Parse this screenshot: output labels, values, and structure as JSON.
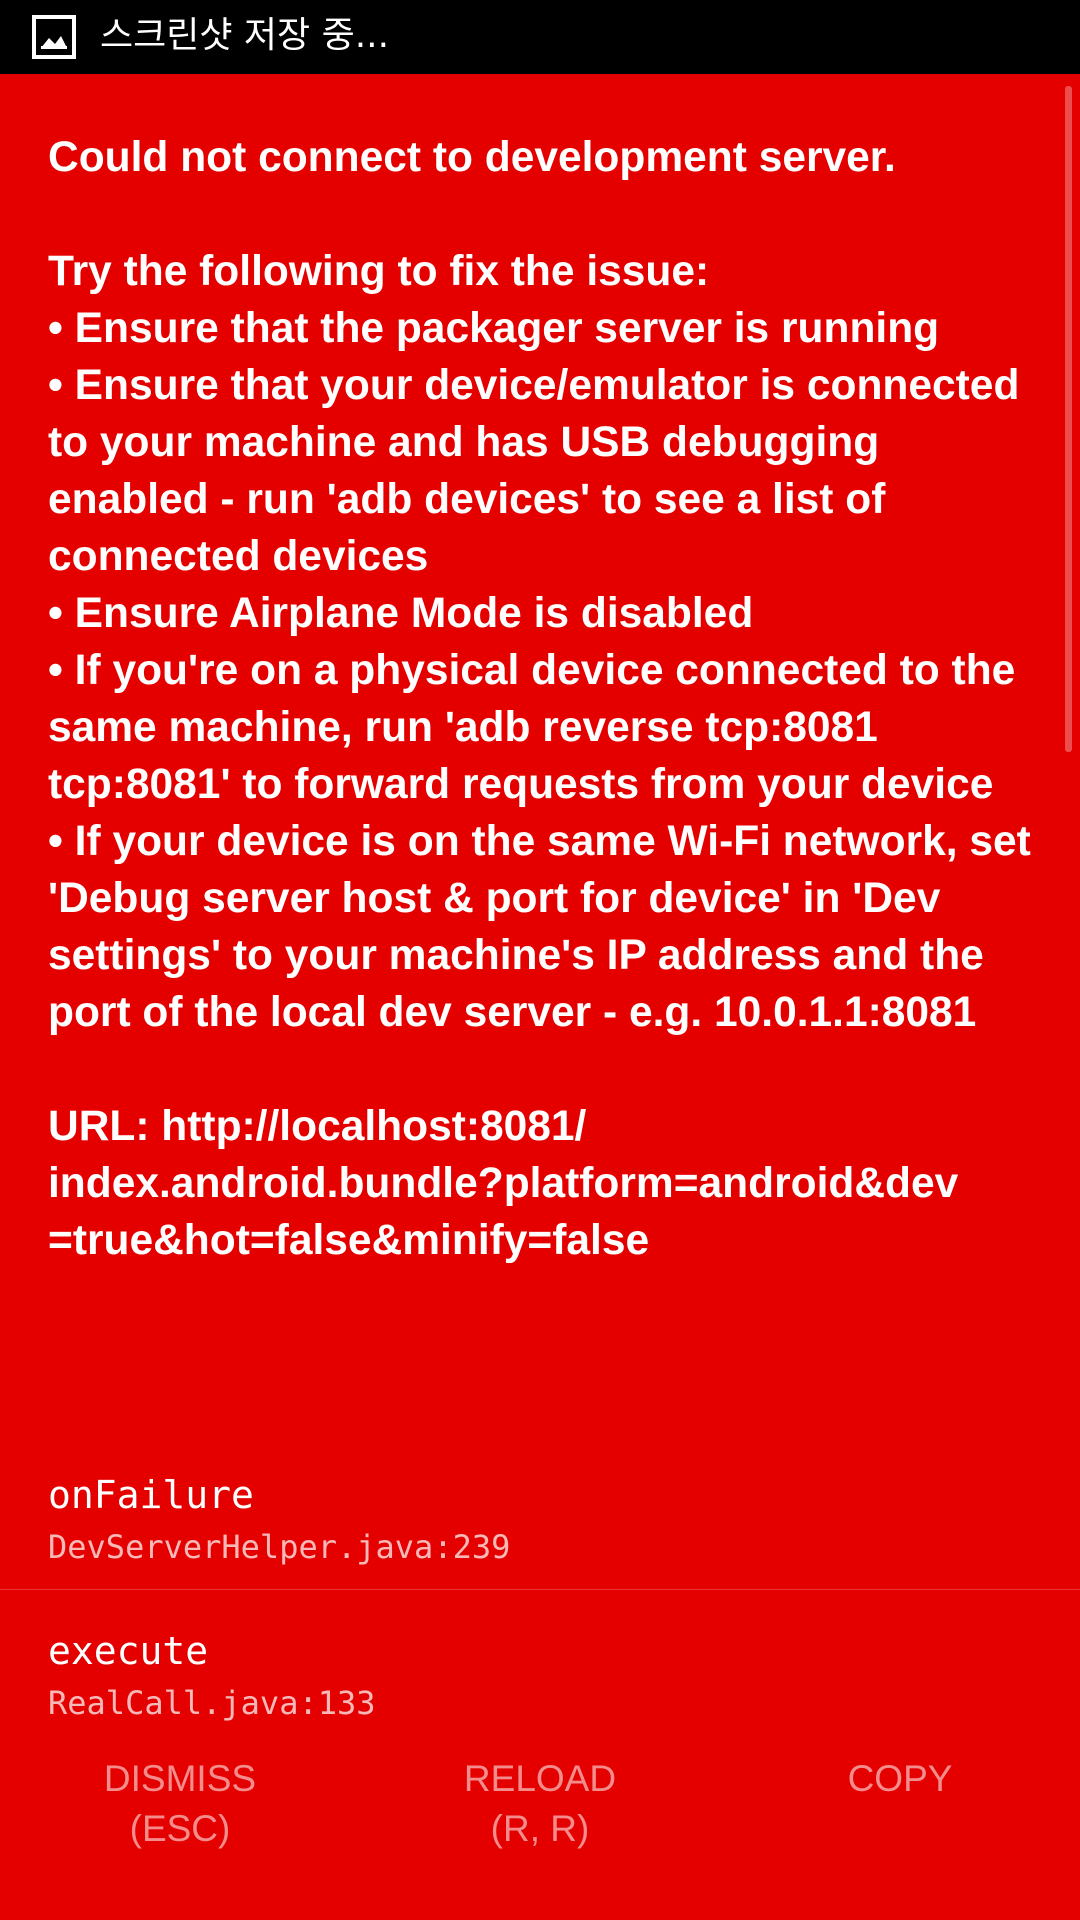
{
  "status_bar": {
    "icon": "image-icon",
    "text": "스크린샷 저장 중..."
  },
  "error": {
    "message": "Could not connect to development server.\n\nTry the following to fix the issue:\n• Ensure that the packager server is running\n• Ensure that your device/emulator is connected to your machine and has USB debugging enabled - run 'adb devices' to see a list of connected devices\n• Ensure Airplane Mode is disabled\n• If you're on a physical device connected to the same machine, run 'adb reverse tcp:8081 tcp:8081' to forward requests from your device\n• If your device is on the same Wi-Fi network, set 'Debug server host & port for device' in 'Dev settings' to your machine's IP address and the port of the local dev server - e.g. 10.0.1.1:8081\n\nURL: http://localhost:8081/\nindex.android.bundle?platform=android&dev\n=true&hot=false&minify=false"
  },
  "stack": [
    {
      "method": "onFailure",
      "location": "DevServerHelper.java:239"
    },
    {
      "method": "execute",
      "location": "RealCall.java:133"
    }
  ],
  "buttons": {
    "dismiss": "DISMISS\n(ESC)",
    "reload": "RELOAD\n(R, R)",
    "copy": "COPY"
  },
  "colors": {
    "background": "#e50000",
    "text": "#ffffff",
    "status_bar": "#000000"
  }
}
